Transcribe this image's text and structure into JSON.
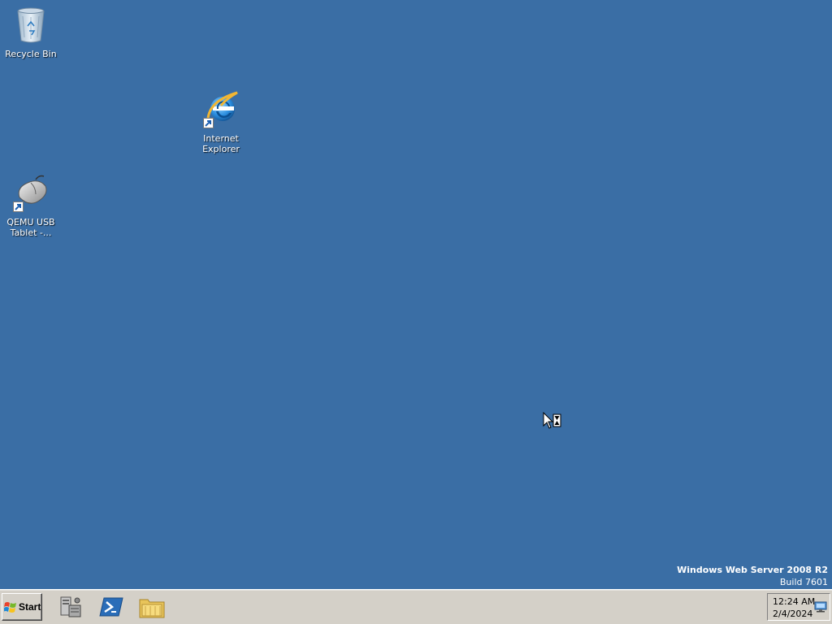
{
  "desktop": {
    "background_color": "#3a6ea5",
    "icons": [
      {
        "label": "Recycle Bin",
        "icon": "recycle-bin-icon"
      },
      {
        "label_line1": "Internet",
        "label_line2": "Explorer",
        "icon": "internet-explorer-icon"
      },
      {
        "label_line1": "QEMU USB",
        "label_line2": "Tablet -...",
        "icon": "mouse-tablet-icon"
      }
    ]
  },
  "watermark": {
    "edition": "Windows Web Server 2008 R2",
    "build": "Build 7601"
  },
  "taskbar": {
    "start_label": "Start",
    "quick_launch": [
      {
        "name": "Server Manager",
        "icon": "server-manager-icon"
      },
      {
        "name": "Windows PowerShell",
        "icon": "powershell-icon"
      },
      {
        "name": "Windows Explorer",
        "icon": "folder-icon"
      }
    ],
    "clock": {
      "time": "12:24 AM",
      "date": "2/4/2024"
    },
    "tray_icon": "network-icon"
  },
  "cursor": "busy-cursor-icon"
}
